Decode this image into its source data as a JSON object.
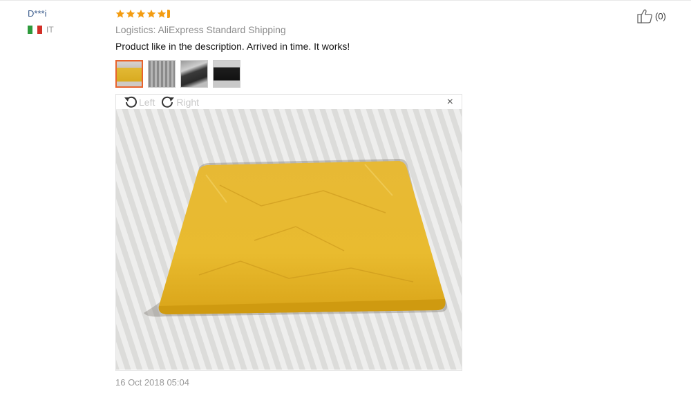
{
  "review": {
    "user": {
      "name": "D***i",
      "country": "IT"
    },
    "rating": 5,
    "logistics": "Logistics: AliExpress Standard Shipping",
    "text": "Product like in the description. Arrived in time. It works!",
    "thumbnails": [
      "photo-1",
      "photo-2",
      "photo-3",
      "photo-4"
    ],
    "viewer": {
      "rotate_left": "Left",
      "rotate_right": "Right",
      "close": "×"
    },
    "date": "16 Oct 2018 05:04",
    "helpful": {
      "count": "(0)"
    }
  },
  "colors": {
    "star": "#f39c12",
    "accent": "#e8632c",
    "username": "#3a5b8c",
    "flag": [
      "#2e9a3c",
      "#ffffff",
      "#d22f27"
    ]
  }
}
